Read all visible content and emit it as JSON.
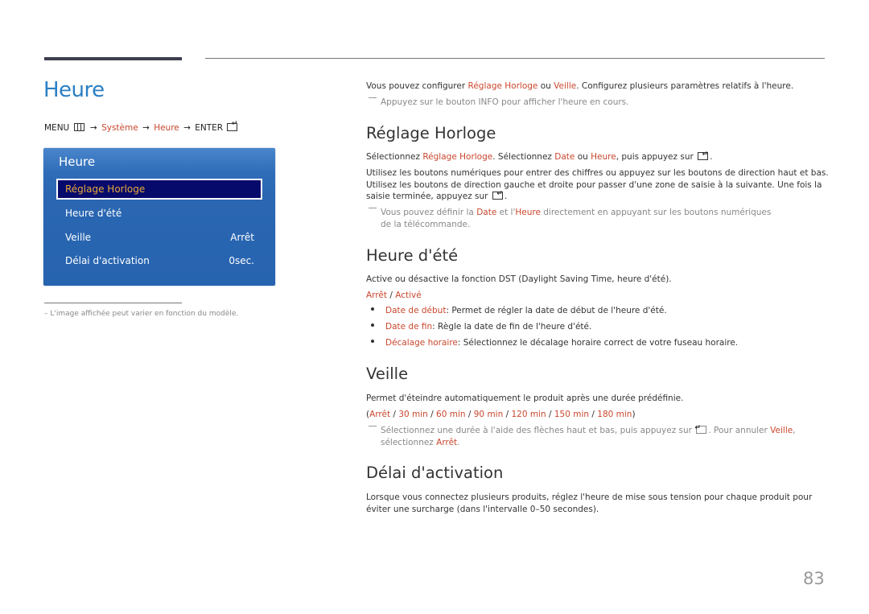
{
  "page": {
    "title": "Heure",
    "number": "83"
  },
  "menu_path": {
    "menu": "MENU",
    "menu_icon": "menu-grid-icon",
    "arrow": "→",
    "system": "Système",
    "heure": "Heure",
    "enter": "ENTER",
    "enter_icon": "enter-icon"
  },
  "osd": {
    "title": "Heure",
    "items": [
      {
        "label": "Réglage Horloge",
        "value": "",
        "selected": true
      },
      {
        "label": "Heure d'été",
        "value": ""
      },
      {
        "label": "Veille",
        "value": "Arrêt"
      },
      {
        "label": "Délai d'activation",
        "value": "0sec."
      }
    ]
  },
  "footnote": "–  L'image affichée peut varier en fonction du modèle.",
  "intro": {
    "t1": "Vous pouvez configurer ",
    "l1": "Réglage Horloge",
    "t2": " ou ",
    "l2": "Veille",
    "t3": ". Configurez plusieurs paramètres relatifs à l'heure.",
    "note": "Appuyez sur le bouton INFO pour afficher l'heure en cours."
  },
  "reglage": {
    "heading": "Réglage Horloge",
    "p1_t1": "Sélectionnez ",
    "p1_l1": "Réglage Horloge",
    "p1_t2": ". Sélectionnez ",
    "p1_l2": "Date",
    "p1_t3": " ou ",
    "p1_l3": "Heure",
    "p1_t4": ", puis appuyez sur",
    "p2": "Utilisez les boutons numériques pour entrer des chiffres ou appuyez sur les boutons de direction haut et bas. Utilisez les boutons de direction gauche et droite pour passer d'une zone de saisie à la suivante. Une fois la saisie terminée, appuyez sur",
    "note_t1": "Vous pouvez définir la ",
    "note_l1": "Date",
    "note_t2": " et l'",
    "note_l2": "Heure",
    "note_t3": " directement en appuyant sur les boutons numériques de la télécommande."
  },
  "dst": {
    "heading": "Heure d'été",
    "desc": "Active ou désactive la fonction DST (Daylight Saving Time, heure d'été).",
    "opt1": "Arrêt",
    "sep": " / ",
    "opt2": "Activé",
    "bullets": [
      {
        "term": "Date de début",
        "text": ": Permet de régler la date de début de l'heure d'été."
      },
      {
        "term": "Date de fin",
        "text": ": Règle la date de fin de l'heure d'été."
      },
      {
        "term": "Décalage horaire",
        "text": ": Sélectionnez le décalage horaire correct de votre fuseau horaire."
      }
    ]
  },
  "veille": {
    "heading": "Veille",
    "desc": "Permet d'éteindre automatiquement le produit après une durée prédéfinie.",
    "options": [
      "Arrêt",
      "30 min",
      "60 min",
      "90 min",
      "120 min",
      "150 min",
      "180 min"
    ],
    "note_t1": "Sélectionnez une durée à l'aide des flèches haut et bas, puis appuyez sur",
    "note_t2": ". Pour annuler ",
    "note_l1": "Veille",
    "note_t3": ", sélectionnez ",
    "note_l2": "Arrêt",
    "note_t4": "."
  },
  "delai": {
    "heading": "Délai d'activation",
    "desc": "Lorsque vous connectez plusieurs produits, réglez l'heure de mise sous tension pour chaque produit pour éviter une surcharge (dans l'intervalle 0–50 secondes)."
  },
  "colors": {
    "title_blue": "#2a7fc4",
    "link_red": "#c9472e",
    "osd_blue": "#2764b0",
    "osd_selected": "#060a6b",
    "osd_selected_text": "#e8a93a"
  }
}
